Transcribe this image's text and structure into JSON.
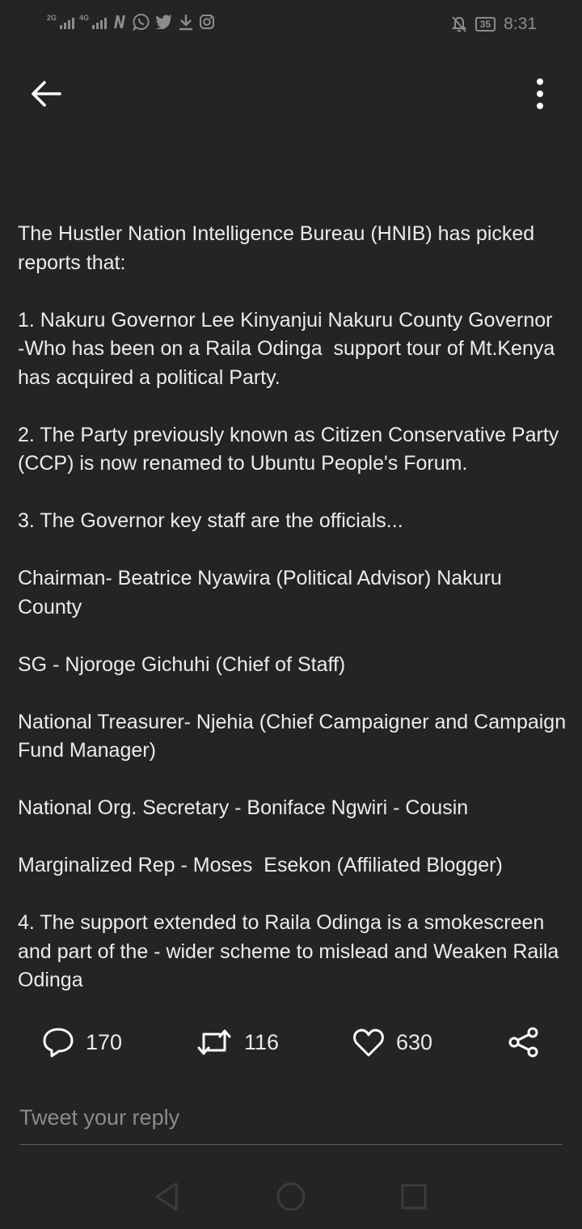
{
  "status_bar": {
    "sim1_network": "2G",
    "sim2_network": "4G",
    "battery_level": "35",
    "time": "8:31",
    "icons": [
      "signal-icon",
      "signal-icon",
      "netflix-icon",
      "whatsapp-icon",
      "twitter-icon",
      "download-icon",
      "instagram-icon",
      "bell-off-icon",
      "battery-icon"
    ]
  },
  "tweet": {
    "text": "The Hustler Nation Intelligence Bureau (HNIB) has picked reports that:\n\n1. Nakuru Governor Lee Kinyanjui Nakuru County Governor  -Who has been on a Raila Odinga  support tour of Mt.Kenya has acquired a political Party.\n\n2. The Party previously known as Citizen Conservative Party (CCP) is now renamed to Ubuntu People's Forum.\n\n3. The Governor key staff are the officials...\n\nChairman- Beatrice Nyawira (Political Advisor) Nakuru County\n\nSG - Njoroge Gichuhi (Chief of Staff)\n\nNational Treasurer- Njehia (Chief Campaigner and Campaign Fund Manager)\n\nNational Org. Secretary - Boniface Ngwiri - Cousin\n\nMarginalized Rep - Moses  Esekon (Affiliated Blogger)\n\n4. The support extended to Raila Odinga is a smokescreen and part of the - wider scheme to mislead and Weaken Raila Odinga"
  },
  "actions": {
    "replies": "170",
    "retweets": "116",
    "likes": "630"
  },
  "reply": {
    "placeholder": "Tweet your reply"
  },
  "colors": {
    "background": "#232426",
    "text": "#ececed",
    "muted": "#8a8b8d"
  }
}
